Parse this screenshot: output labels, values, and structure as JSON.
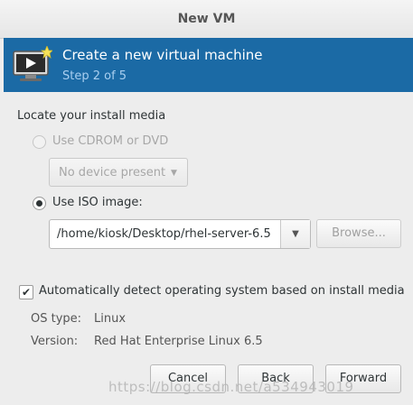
{
  "window": {
    "title": "New VM"
  },
  "banner": {
    "title": "Create a new virtual machine",
    "step": "Step 2 of 5",
    "icon": "monitor-new-icon"
  },
  "media": {
    "heading": "Locate your install media",
    "cdrom_label": "Use CDROM or DVD",
    "device_select_value": "No device present",
    "iso_label": "Use ISO image:",
    "iso_path": "/home/kiosk/Desktop/rhel-server-6.5",
    "browse_label": "Browse...",
    "selected": "iso"
  },
  "detect": {
    "checked": true,
    "label": "Automatically detect operating system based on install media"
  },
  "os_info": {
    "type_label": "OS type:",
    "type_value": "Linux",
    "version_label": "Version:",
    "version_value": "Red Hat Enterprise Linux 6.5"
  },
  "buttons": {
    "cancel": "Cancel",
    "back": "Back",
    "forward": "Forward"
  },
  "watermark": "https://blog.csdn.net/a534943019"
}
